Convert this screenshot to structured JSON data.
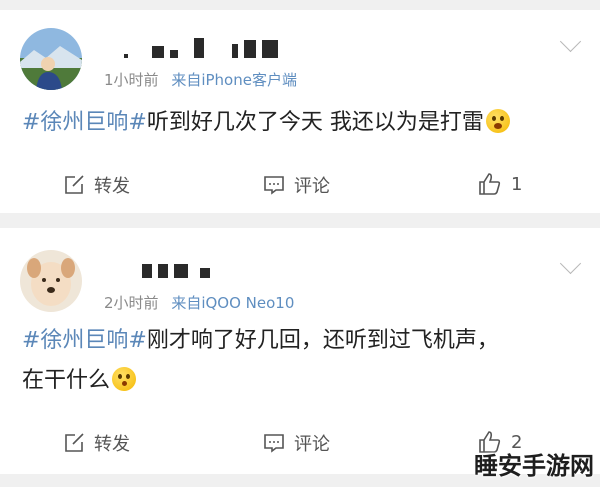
{
  "feed": {
    "posts": [
      {
        "time": "1小时前",
        "source": "来自iPhone客户端",
        "hashtag": "#徐州巨响#",
        "text_line1": "听到好几次了今天 我还以为是打雷",
        "text_line2": "",
        "emoji": "scream-face-emoji",
        "actions": {
          "repost": "转发",
          "comment": "评论",
          "like_count": "1"
        }
      },
      {
        "time": "2小时前",
        "source": "来自iQOO Neo10",
        "hashtag": "#徐州巨响#",
        "text_line1": "刚才响了好几回，还听到过飞机声，",
        "text_line2": "在干什么",
        "emoji": "thinking-face-emoji",
        "actions": {
          "repost": "转发",
          "comment": "评论",
          "like_count": "2"
        }
      }
    ]
  },
  "watermark": "睡安手游网",
  "colors": {
    "link": "#5b87b8",
    "meta": "#8a8a8a",
    "background": "#f0f0f0"
  }
}
